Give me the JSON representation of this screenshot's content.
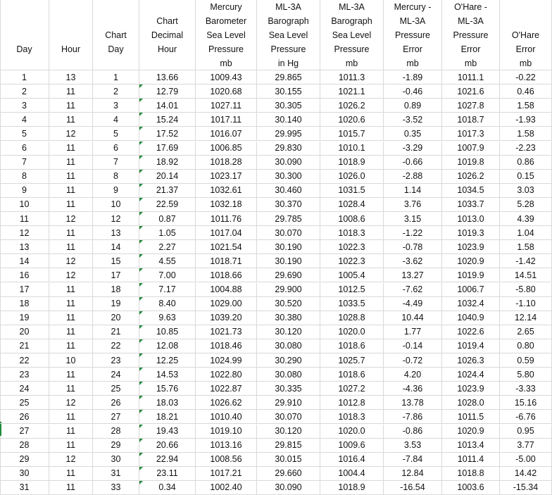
{
  "columns": [
    {
      "key": "day",
      "header": [
        "",
        "",
        "",
        "Day",
        ""
      ]
    },
    {
      "key": "hour",
      "header": [
        "",
        "",
        "",
        "Hour",
        ""
      ]
    },
    {
      "key": "chart_day",
      "header": [
        "",
        "",
        "Chart",
        "Day",
        ""
      ]
    },
    {
      "key": "chart_decimal_hour",
      "header": [
        "",
        "Chart",
        "Decimal",
        "Hour",
        ""
      ]
    },
    {
      "key": "mercury_barometer_slp",
      "header": [
        "Mercury",
        "Barometer",
        "Sea Level",
        "Pressure",
        "mb"
      ]
    },
    {
      "key": "ml3a_barograph_slp_inhg",
      "header": [
        "ML-3A",
        "Barograph",
        "Sea Level",
        "Pressure",
        "in Hg"
      ]
    },
    {
      "key": "ml3a_barograph_slp_mb",
      "header": [
        "ML-3A",
        "Barograph",
        "Sea Level",
        "Pressure",
        "mb"
      ]
    },
    {
      "key": "mercury_ml3a_error",
      "header": [
        "Mercury -",
        "ML-3A",
        "Pressure",
        "Error",
        "mb"
      ]
    },
    {
      "key": "ohare_ml3a_error",
      "header": [
        "O'Hare -",
        "ML-3A",
        "Pressure",
        "Error",
        "mb"
      ]
    },
    {
      "key": "ohare_error",
      "header": [
        "",
        "",
        "O'Hare",
        "Error",
        "mb"
      ]
    }
  ],
  "rows": [
    [
      "1",
      "13",
      "1",
      "13.66",
      "1009.43",
      "29.865",
      "1011.3",
      "-1.89",
      "1011.1",
      "-0.22"
    ],
    [
      "2",
      "11",
      "2",
      "12.79",
      "1020.68",
      "30.155",
      "1021.1",
      "-0.46",
      "1021.6",
      "0.46"
    ],
    [
      "3",
      "11",
      "3",
      "14.01",
      "1027.11",
      "30.305",
      "1026.2",
      "0.89",
      "1027.8",
      "1.58"
    ],
    [
      "4",
      "11",
      "4",
      "15.24",
      "1017.11",
      "30.140",
      "1020.6",
      "-3.52",
      "1018.7",
      "-1.93"
    ],
    [
      "5",
      "12",
      "5",
      "17.52",
      "1016.07",
      "29.995",
      "1015.7",
      "0.35",
      "1017.3",
      "1.58"
    ],
    [
      "6",
      "11",
      "6",
      "17.69",
      "1006.85",
      "29.830",
      "1010.1",
      "-3.29",
      "1007.9",
      "-2.23"
    ],
    [
      "7",
      "11",
      "7",
      "18.92",
      "1018.28",
      "30.090",
      "1018.9",
      "-0.66",
      "1019.8",
      "0.86"
    ],
    [
      "8",
      "11",
      "8",
      "20.14",
      "1023.17",
      "30.300",
      "1026.0",
      "-2.88",
      "1026.2",
      "0.15"
    ],
    [
      "9",
      "11",
      "9",
      "21.37",
      "1032.61",
      "30.460",
      "1031.5",
      "1.14",
      "1034.5",
      "3.03"
    ],
    [
      "10",
      "11",
      "10",
      "22.59",
      "1032.18",
      "30.370",
      "1028.4",
      "3.76",
      "1033.7",
      "5.28"
    ],
    [
      "11",
      "12",
      "12",
      "0.87",
      "1011.76",
      "29.785",
      "1008.6",
      "3.15",
      "1013.0",
      "4.39"
    ],
    [
      "12",
      "11",
      "13",
      "1.05",
      "1017.04",
      "30.070",
      "1018.3",
      "-1.22",
      "1019.3",
      "1.04"
    ],
    [
      "13",
      "11",
      "14",
      "2.27",
      "1021.54",
      "30.190",
      "1022.3",
      "-0.78",
      "1023.9",
      "1.58"
    ],
    [
      "14",
      "12",
      "15",
      "4.55",
      "1018.71",
      "30.190",
      "1022.3",
      "-3.62",
      "1020.9",
      "-1.42"
    ],
    [
      "16",
      "12",
      "17",
      "7.00",
      "1018.66",
      "29.690",
      "1005.4",
      "13.27",
      "1019.9",
      "14.51"
    ],
    [
      "17",
      "11",
      "18",
      "7.17",
      "1004.88",
      "29.900",
      "1012.5",
      "-7.62",
      "1006.7",
      "-5.80"
    ],
    [
      "18",
      "11",
      "19",
      "8.40",
      "1029.00",
      "30.520",
      "1033.5",
      "-4.49",
      "1032.4",
      "-1.10"
    ],
    [
      "19",
      "11",
      "20",
      "9.63",
      "1039.20",
      "30.380",
      "1028.8",
      "10.44",
      "1040.9",
      "12.14"
    ],
    [
      "20",
      "11",
      "21",
      "10.85",
      "1021.73",
      "30.120",
      "1020.0",
      "1.77",
      "1022.6",
      "2.65"
    ],
    [
      "21",
      "11",
      "22",
      "12.08",
      "1018.46",
      "30.080",
      "1018.6",
      "-0.14",
      "1019.4",
      "0.80"
    ],
    [
      "22",
      "10",
      "23",
      "12.25",
      "1024.99",
      "30.290",
      "1025.7",
      "-0.72",
      "1026.3",
      "0.59"
    ],
    [
      "23",
      "11",
      "24",
      "14.53",
      "1022.80",
      "30.080",
      "1018.6",
      "4.20",
      "1024.4",
      "5.80"
    ],
    [
      "24",
      "11",
      "25",
      "15.76",
      "1022.87",
      "30.335",
      "1027.2",
      "-4.36",
      "1023.9",
      "-3.33"
    ],
    [
      "25",
      "12",
      "26",
      "18.03",
      "1026.62",
      "29.910",
      "1012.8",
      "13.78",
      "1028.0",
      "15.16"
    ],
    [
      "26",
      "11",
      "27",
      "18.21",
      "1010.40",
      "30.070",
      "1018.3",
      "-7.86",
      "1011.5",
      "-6.76"
    ],
    [
      "27",
      "11",
      "28",
      "19.43",
      "1019.10",
      "30.120",
      "1020.0",
      "-0.86",
      "1020.9",
      "0.95"
    ],
    [
      "28",
      "11",
      "29",
      "20.66",
      "1013.16",
      "29.815",
      "1009.6",
      "3.53",
      "1013.4",
      "3.77"
    ],
    [
      "29",
      "12",
      "30",
      "22.94",
      "1008.56",
      "30.015",
      "1016.4",
      "-7.84",
      "1011.4",
      "-5.00"
    ],
    [
      "30",
      "11",
      "31",
      "23.11",
      "1017.21",
      "29.660",
      "1004.4",
      "12.84",
      "1018.8",
      "14.42"
    ],
    [
      "31",
      "11",
      "33",
      "0.34",
      "1002.40",
      "30.090",
      "1018.9",
      "-16.54",
      "1003.6",
      "-15.34"
    ]
  ]
}
